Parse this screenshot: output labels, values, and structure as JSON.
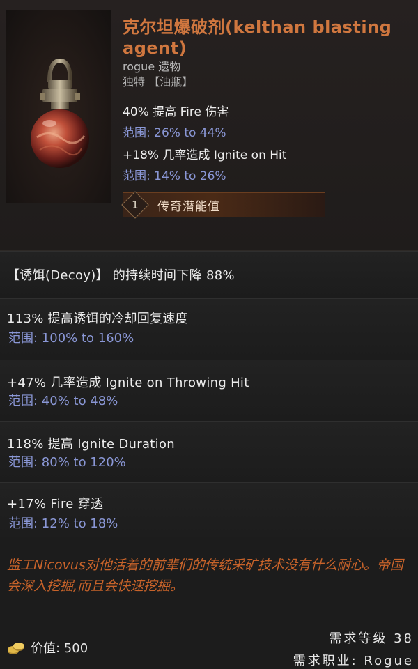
{
  "item": {
    "name": "克尔坦爆破剂(kelthan blasting agent)",
    "class_line": "rogue 遗物",
    "rarity_line": "独特 【油瓶】",
    "icon": "potion-flask-icon"
  },
  "base_affixes": [
    {
      "text": "40% 提高 Fire 伤害",
      "range": "范围: 26% to 44%"
    },
    {
      "text": "+18% 几率造成 Ignite on Hit",
      "range": "范围: 14% to 26%"
    }
  ],
  "legendary_potential": {
    "value": "1",
    "label": "传奇潜能值"
  },
  "unique_mods": [
    {
      "text": "【诱饵(Decoy)】 的持续时间下降 88%",
      "range": ""
    },
    {
      "text": "113% 提高诱饵的冷却回复速度",
      "range": "范围: 100% to 160%"
    },
    {
      "text": "+47% 几率造成 Ignite on Throwing Hit",
      "range": "范围: 40% to 48%"
    },
    {
      "text": "118% 提高 Ignite Duration",
      "range": "范围: 80% to 120%"
    },
    {
      "text": "+17% Fire 穿透",
      "range": "范围: 12% to 18%"
    }
  ],
  "lore": "监工Nicovus对他活着的前辈们的传统采矿技术没有什么耐心。帝国会深入挖掘,而且会快速挖掘。",
  "footer": {
    "value_label": "价值: 500",
    "required_level": "需求等级 38",
    "required_class": "需求职业: Rogue",
    "coin_icon": "gold-coin-icon"
  },
  "colors": {
    "title": "#d0773f",
    "range": "#8a97d6",
    "lore": "#c8632a",
    "background": "#1b1b1b"
  }
}
